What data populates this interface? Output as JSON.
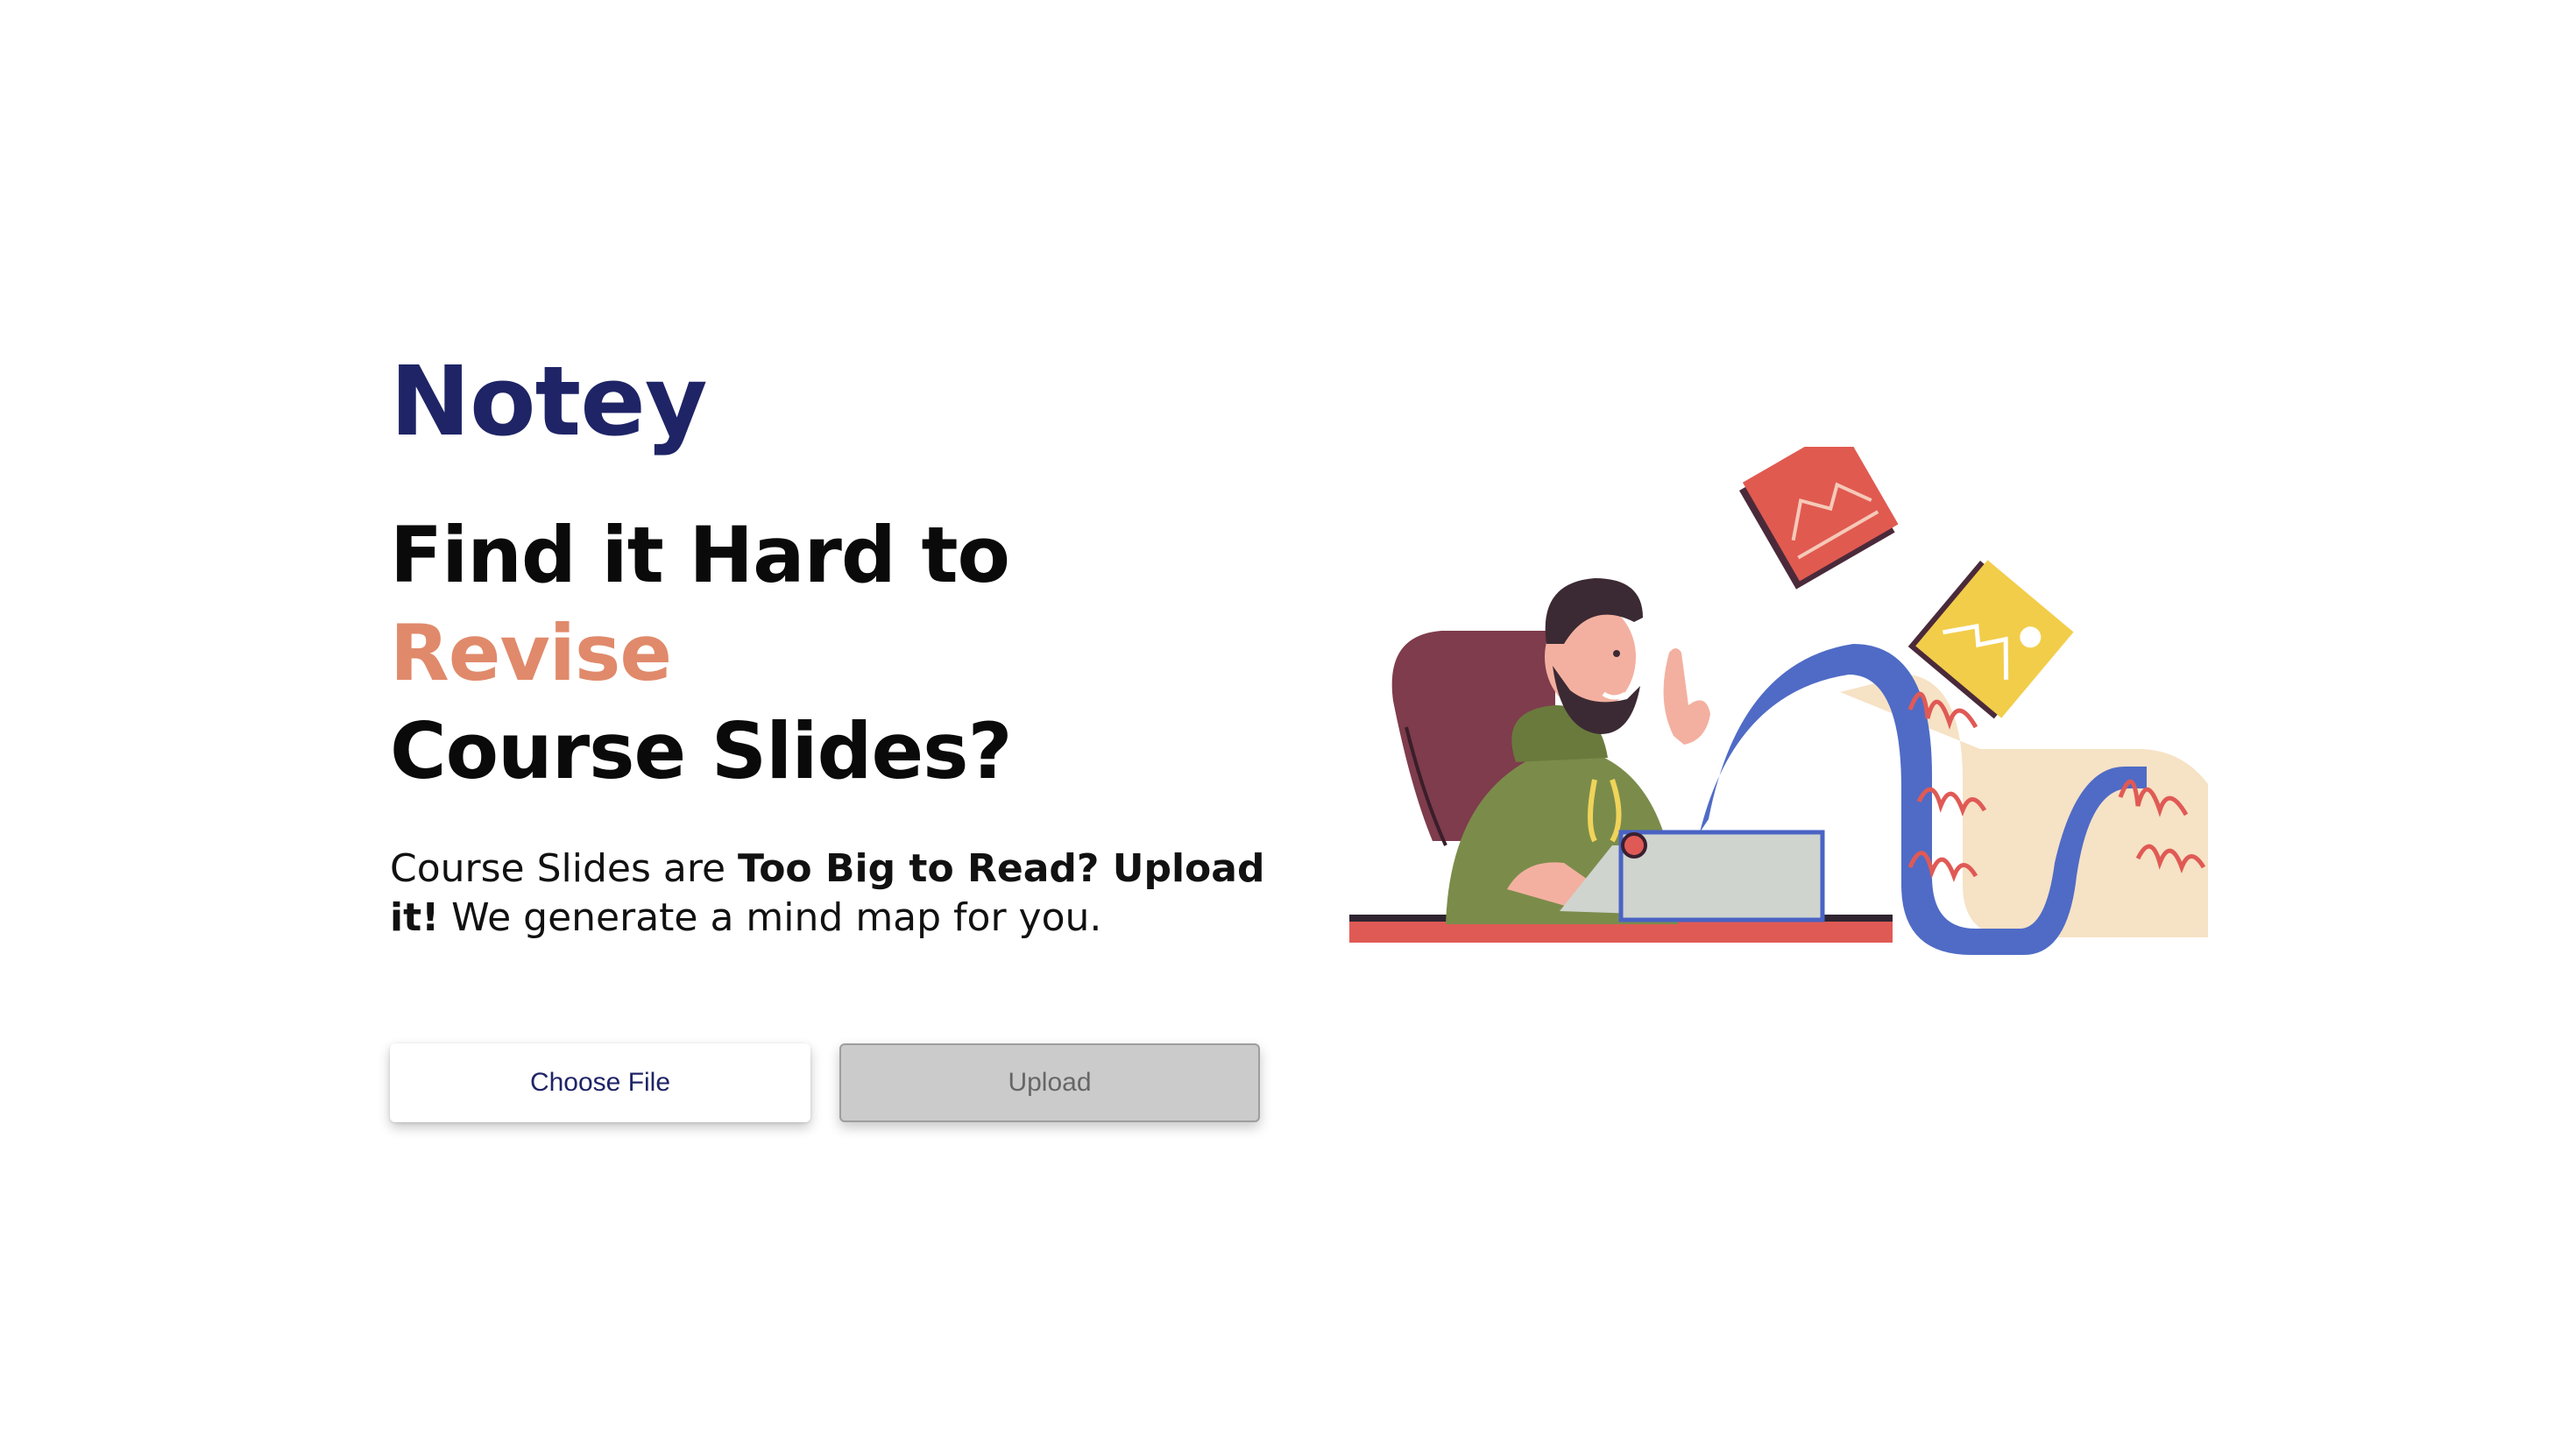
{
  "brand": {
    "name": "Notey"
  },
  "hero": {
    "line1": "Find it Hard to",
    "accent": "Revise",
    "line3": "Course Slides?",
    "desc_part1": "Course Slides are ",
    "desc_bold": "Too Big to Read? Upload it!",
    "desc_part2": " We generate a mind map for you."
  },
  "actions": {
    "choose_label": "Choose File",
    "upload_label": "Upload"
  },
  "colors": {
    "brand": "#1f2466",
    "accent": "#e08a6b",
    "upload_disabled": "#cbcbcb"
  },
  "illustration": {
    "name": "man-typing-on-typewriter-illustration"
  }
}
